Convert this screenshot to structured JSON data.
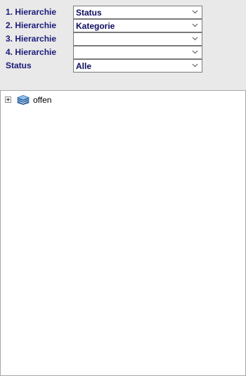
{
  "filters": [
    {
      "label": "1. Hierarchie",
      "value": "Status"
    },
    {
      "label": "2. Hierarchie",
      "value": "Kategorie"
    },
    {
      "label": "3. Hierarchie",
      "value": ""
    },
    {
      "label": "4. Hierarchie",
      "value": ""
    },
    {
      "label": "Status",
      "value": "Alle"
    }
  ],
  "tree": {
    "nodes": [
      {
        "label": "offen",
        "icon": "stack-icon",
        "expanded": false
      }
    ]
  },
  "colors": {
    "label_text": "#1a1a7a",
    "panel_background": "#e9e9e9",
    "tree_background": "#ffffff",
    "icon_blue": "#4a90d9"
  }
}
